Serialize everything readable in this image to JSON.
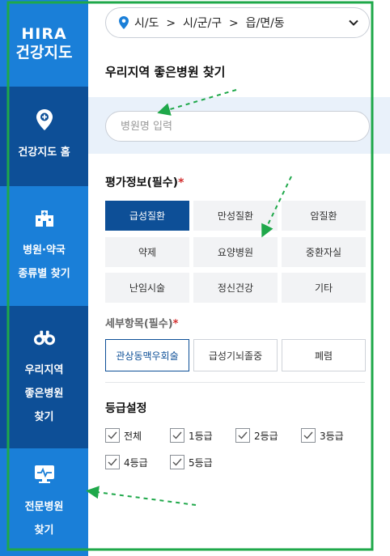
{
  "sidebar": {
    "brand_line1": "HIRA",
    "brand_line2": "건강지도",
    "items": [
      {
        "label": "건강지도 홈",
        "icon": "location-pin-icon"
      },
      {
        "label": "병원·약국\n종류별 찾기",
        "icon": "hospital-building-icon"
      },
      {
        "label": "우리지역\n좋은병원\n찾기",
        "icon": "binoculars-icon"
      },
      {
        "label": "전문병원\n찾기",
        "icon": "monitor-health-icon"
      }
    ]
  },
  "region": {
    "label": "시/도  >  시/군/구  >  읍/면/동"
  },
  "main": {
    "title": "우리지역 좋은병원 찾기",
    "search_placeholder": "병원명 입력"
  },
  "evaluation": {
    "title": "평가정보(필수)",
    "required_mark": "*",
    "buttons": [
      "급성질환",
      "만성질환",
      "암질환",
      "약제",
      "요양병원",
      "중환자실",
      "난임시술",
      "정신건강",
      "기타"
    ],
    "selected": "급성질환"
  },
  "detail": {
    "title": "세부항목(필수)",
    "required_mark": "*",
    "buttons": [
      "관상동맥우회술",
      "급성기뇌졸중",
      "폐렴"
    ],
    "selected": "관상동맥우회술"
  },
  "grade": {
    "title": "등급설정",
    "options": [
      "전체",
      "1등급",
      "2등급",
      "3등급",
      "4등급",
      "5등급"
    ],
    "checked": [
      true,
      true,
      true,
      true,
      true,
      true
    ]
  },
  "colors": {
    "sidebar_dark": "#0d4f97",
    "sidebar_light": "#1a7fd8",
    "annotation_frame": "#1fa84a",
    "required": "#d32f2f"
  }
}
